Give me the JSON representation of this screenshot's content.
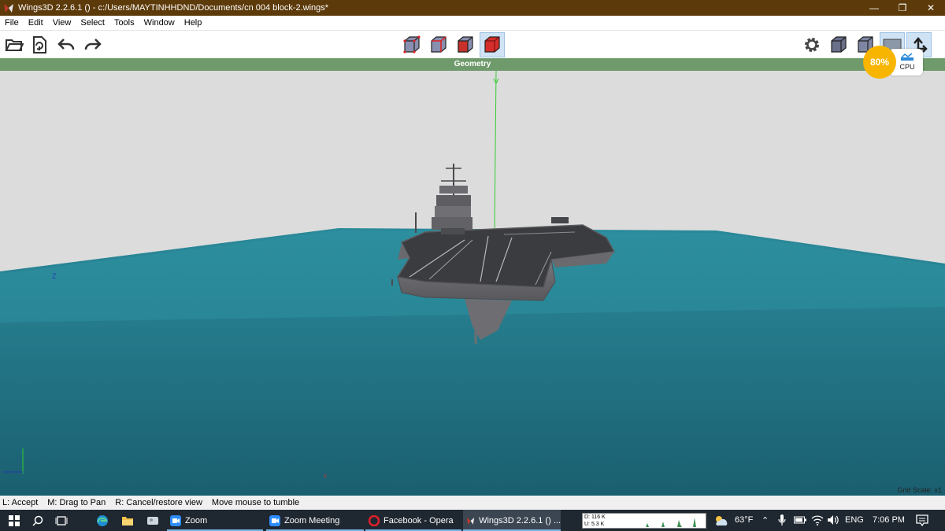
{
  "window": {
    "title": "Wings3D 2.2.6.1 () - c:/Users/MAYTINHHDND/Documents/cn 004 block-2.wings*",
    "controls": {
      "minimize": "—",
      "restore": "❐",
      "close": "✕"
    }
  },
  "menu": [
    "File",
    "Edit",
    "View",
    "Select",
    "Tools",
    "Window",
    "Help"
  ],
  "toolbar": {
    "left_icons": [
      "open-folder-icon",
      "import-icon",
      "undo-icon",
      "redo-icon"
    ],
    "selection_modes": [
      "vertex-mode-icon",
      "edge-mode-icon",
      "face-mode-icon",
      "body-mode-icon"
    ],
    "active_mode": "body-mode-icon",
    "right_icons": [
      "settings-icon",
      "cube-view-icon",
      "cube-flat-icon",
      "screen-icon",
      "arrows-icon"
    ]
  },
  "geometry": {
    "header": "Geometry"
  },
  "viewport": {
    "axis_label_z": "Z",
    "grid_scale": "Grid Scale: x1",
    "colors": {
      "sky": "#dcdcdc",
      "sea": "#1d6f80",
      "sea_top": "#2b8a9a",
      "ship": "#5f5f63",
      "deck": "#3a3c40",
      "y_axis": "#33cc33"
    }
  },
  "cpu": {
    "percent": "80%",
    "label": "CPU"
  },
  "status": {
    "items": [
      "L: Accept",
      "M: Drag to Pan",
      "R: Cancel/restore view",
      "Move mouse to tumble"
    ]
  },
  "taskbar": {
    "apps": [
      {
        "label": "Zoom",
        "icon": "zoom-icon"
      },
      {
        "label": "Zoom Meeting",
        "icon": "zoom-icon"
      },
      {
        "label": "Facebook - Opera",
        "icon": "opera-icon"
      },
      {
        "label": "Wings3D 2.2.6.1 () ...",
        "icon": "wings3d-icon"
      }
    ],
    "net_down": "D: 116 K",
    "net_up": "U: 5.3 K",
    "temperature": "63°F",
    "language": "ENG",
    "time": "7:06 PM"
  }
}
